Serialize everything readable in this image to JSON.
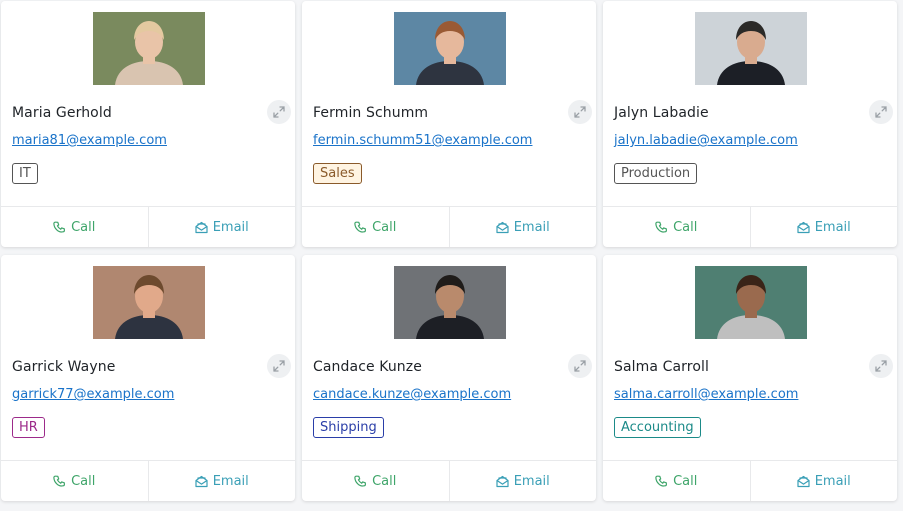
{
  "cards": [
    {
      "name": "Maria Gerhold",
      "email": "maria81@example.com",
      "department": "IT",
      "tag_color": "#555555",
      "tag_bg": "#ffffff",
      "photo": {
        "bg": "#7a8a5e",
        "skin": "#e9c4a8",
        "hair": "#e4c9a0",
        "shirt": "#d9c4b0"
      }
    },
    {
      "name": "Fermin Schumm",
      "email": "fermin.schumm51@example.com",
      "department": "Sales",
      "tag_color": "#8a5a2a",
      "tag_bg": "#fff4e2",
      "photo": {
        "bg": "#5d87a4",
        "skin": "#e6b89c",
        "hair": "#9a5a34",
        "shirt": "#2e3440"
      }
    },
    {
      "name": "Jalyn Labadie",
      "email": "jalyn.labadie@example.com",
      "department": "Production",
      "tag_color": "#555555",
      "tag_bg": "#ffffff",
      "photo": {
        "bg": "#cdd3d8",
        "skin": "#d9ab8f",
        "hair": "#2b2a28",
        "shirt": "#1c1f26"
      }
    },
    {
      "name": "Garrick Wayne",
      "email": "garrick77@example.com",
      "department": "HR",
      "tag_color": "#9c2a8a",
      "tag_bg": "#ffffff",
      "photo": {
        "bg": "#b08770",
        "skin": "#e1a98a",
        "hair": "#6d4a2e",
        "shirt": "#2d3340"
      }
    },
    {
      "name": "Candace Kunze",
      "email": "candace.kunze@example.com",
      "department": "Shipping",
      "tag_color": "#2a3ea8",
      "tag_bg": "#ffffff",
      "photo": {
        "bg": "#6f7276",
        "skin": "#b98a6c",
        "hair": "#1f1c1a",
        "shirt": "#1d1f25"
      }
    },
    {
      "name": "Salma Carroll",
      "email": "salma.carroll@example.com",
      "department": "Accounting",
      "tag_color": "#1b8a88",
      "tag_bg": "#ffffff",
      "photo": {
        "bg": "#4f7f72",
        "skin": "#9a6a4e",
        "hair": "#3a2418",
        "shirt": "#bfbfbf"
      }
    }
  ],
  "actions": {
    "call_label": "Call",
    "email_label": "Email"
  },
  "colors": {
    "call": "#3fa56a",
    "email": "#3a9fb6",
    "link": "#1a73c9"
  }
}
